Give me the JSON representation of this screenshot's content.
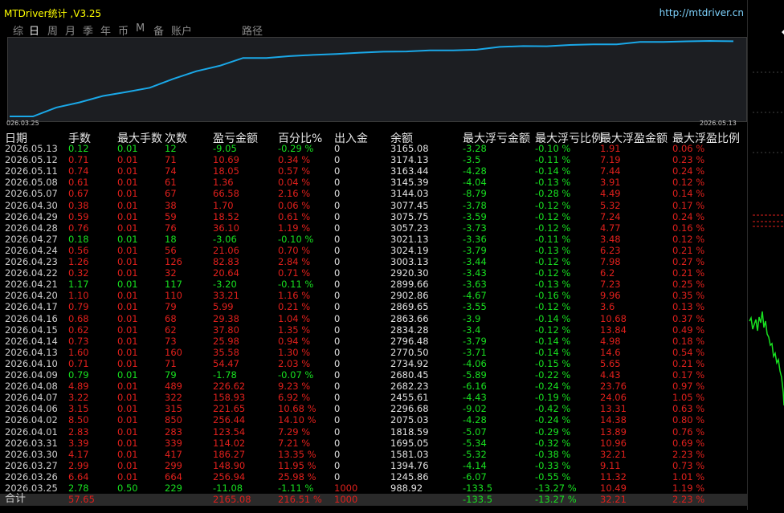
{
  "app": {
    "title": "MTDriver统计 ,V3.25",
    "url": "http://mtdriver.cn"
  },
  "tabs": [
    {
      "label": "综",
      "active": false
    },
    {
      "label": "日",
      "active": true
    },
    {
      "label": "周",
      "active": false
    },
    {
      "label": "月",
      "active": false
    },
    {
      "label": "季",
      "active": false
    },
    {
      "label": "年",
      "active": false
    },
    {
      "label": "币",
      "active": false
    },
    {
      "label": "M",
      "active": false
    },
    {
      "label": "备",
      "active": false
    },
    {
      "label": "账户",
      "active": false
    },
    {
      "label": "路径",
      "active": false
    }
  ],
  "chart_data": {
    "type": "line",
    "x_start": "026.03.25",
    "x_end": "2026.05.13",
    "series": [
      {
        "values": [
          988.92,
          988.92,
          1245.86,
          1394.76,
          1581.03,
          1695.05,
          1818.59,
          2075.03,
          2296.68,
          2455.61,
          2682.23,
          2680.45,
          2734.92,
          2770.5,
          2796.48,
          2834.28,
          2863.66,
          2869.65,
          2902.86,
          2899.66,
          2920.3,
          3003.13,
          3024.19,
          3021.13,
          3057.23,
          3075.75,
          3077.45,
          3144.03,
          3145.39,
          3163.44,
          3174.13,
          3165.08
        ]
      }
    ],
    "color": "#1aa8e8"
  },
  "table": {
    "headers": [
      "日期",
      "手数",
      "最大手数",
      "次数",
      "盈亏金额",
      "百分比%",
      "出入金",
      "余额",
      "最大浮亏金额",
      "最大浮亏比例",
      "最大浮盈金额",
      "最大浮盈比例"
    ],
    "rows": [
      [
        "2026.05.13",
        "0.12",
        "0.01",
        "12",
        "-9.05",
        "-0.29 %",
        "0",
        "3165.08",
        "-3.28",
        "-0.10 %",
        "1.91",
        "0.06 %"
      ],
      [
        "2026.05.12",
        "0.71",
        "0.01",
        "71",
        "10.69",
        "0.34 %",
        "0",
        "3174.13",
        "-3.5",
        "-0.11 %",
        "7.19",
        "0.23 %"
      ],
      [
        "2026.05.11",
        "0.74",
        "0.01",
        "74",
        "18.05",
        "0.57 %",
        "0",
        "3163.44",
        "-4.28",
        "-0.14 %",
        "7.44",
        "0.24 %"
      ],
      [
        "2026.05.08",
        "0.61",
        "0.01",
        "61",
        "1.36",
        "0.04 %",
        "0",
        "3145.39",
        "-4.04",
        "-0.13 %",
        "3.91",
        "0.12 %"
      ],
      [
        "2026.05.07",
        "0.67",
        "0.01",
        "67",
        "66.58",
        "2.16 %",
        "0",
        "3144.03",
        "-8.79",
        "-0.28 %",
        "4.49",
        "0.14 %"
      ],
      [
        "2026.04.30",
        "0.38",
        "0.01",
        "38",
        "1.70",
        "0.06 %",
        "0",
        "3077.45",
        "-3.78",
        "-0.12 %",
        "5.32",
        "0.17 %"
      ],
      [
        "2026.04.29",
        "0.59",
        "0.01",
        "59",
        "18.52",
        "0.61 %",
        "0",
        "3075.75",
        "-3.59",
        "-0.12 %",
        "7.24",
        "0.24 %"
      ],
      [
        "2026.04.28",
        "0.76",
        "0.01",
        "76",
        "36.10",
        "1.19 %",
        "0",
        "3057.23",
        "-3.73",
        "-0.12 %",
        "4.77",
        "0.16 %"
      ],
      [
        "2026.04.27",
        "0.18",
        "0.01",
        "18",
        "-3.06",
        "-0.10 %",
        "0",
        "3021.13",
        "-3.36",
        "-0.11 %",
        "3.48",
        "0.12 %"
      ],
      [
        "2026.04.24",
        "0.56",
        "0.01",
        "56",
        "21.06",
        "0.70 %",
        "0",
        "3024.19",
        "-3.79",
        "-0.13 %",
        "6.23",
        "0.21 %"
      ],
      [
        "2026.04.23",
        "1.26",
        "0.01",
        "126",
        "82.83",
        "2.84 %",
        "0",
        "3003.13",
        "-3.44",
        "-0.12 %",
        "7.98",
        "0.27 %"
      ],
      [
        "2026.04.22",
        "0.32",
        "0.01",
        "32",
        "20.64",
        "0.71 %",
        "0",
        "2920.30",
        "-3.43",
        "-0.12 %",
        "6.2",
        "0.21 %"
      ],
      [
        "2026.04.21",
        "1.17",
        "0.01",
        "117",
        "-3.20",
        "-0.11 %",
        "0",
        "2899.66",
        "-3.63",
        "-0.13 %",
        "7.23",
        "0.25 %"
      ],
      [
        "2026.04.20",
        "1.10",
        "0.01",
        "110",
        "33.21",
        "1.16 %",
        "0",
        "2902.86",
        "-4.67",
        "-0.16 %",
        "9.96",
        "0.35 %"
      ],
      [
        "2026.04.17",
        "0.79",
        "0.01",
        "79",
        "5.99",
        "0.21 %",
        "0",
        "2869.65",
        "-3.55",
        "-0.12 %",
        "3.6",
        "0.13 %"
      ],
      [
        "2026.04.16",
        "0.68",
        "0.01",
        "68",
        "29.38",
        "1.04 %",
        "0",
        "2863.66",
        "-3.9",
        "-0.14 %",
        "10.68",
        "0.37 %"
      ],
      [
        "2026.04.15",
        "0.62",
        "0.01",
        "62",
        "37.80",
        "1.35 %",
        "0",
        "2834.28",
        "-3.4",
        "-0.12 %",
        "13.84",
        "0.49 %"
      ],
      [
        "2026.04.14",
        "0.73",
        "0.01",
        "73",
        "25.98",
        "0.94 %",
        "0",
        "2796.48",
        "-3.79",
        "-0.14 %",
        "4.98",
        "0.18 %"
      ],
      [
        "2026.04.13",
        "1.60",
        "0.01",
        "160",
        "35.58",
        "1.30 %",
        "0",
        "2770.50",
        "-3.71",
        "-0.14 %",
        "14.6",
        "0.54 %"
      ],
      [
        "2026.04.10",
        "0.71",
        "0.01",
        "71",
        "54.47",
        "2.03 %",
        "0",
        "2734.92",
        "-4.06",
        "-0.15 %",
        "5.65",
        "0.21 %"
      ],
      [
        "2026.04.09",
        "0.79",
        "0.01",
        "79",
        "-1.78",
        "-0.07 %",
        "0",
        "2680.45",
        "-5.89",
        "-0.22 %",
        "4.43",
        "0.17 %"
      ],
      [
        "2026.04.08",
        "4.89",
        "0.01",
        "489",
        "226.62",
        "9.23 %",
        "0",
        "2682.23",
        "-6.16",
        "-0.24 %",
        "23.76",
        "0.97 %"
      ],
      [
        "2026.04.07",
        "3.22",
        "0.01",
        "322",
        "158.93",
        "6.92 %",
        "0",
        "2455.61",
        "-4.43",
        "-0.19 %",
        "24.06",
        "1.05 %"
      ],
      [
        "2026.04.06",
        "3.15",
        "0.01",
        "315",
        "221.65",
        "10.68 %",
        "0",
        "2296.68",
        "-9.02",
        "-0.42 %",
        "13.31",
        "0.63 %"
      ],
      [
        "2026.04.02",
        "8.50",
        "0.01",
        "850",
        "256.44",
        "14.10 %",
        "0",
        "2075.03",
        "-4.28",
        "-0.24 %",
        "14.38",
        "0.80 %"
      ],
      [
        "2026.04.01",
        "2.83",
        "0.01",
        "283",
        "123.54",
        "7.29 %",
        "0",
        "1818.59",
        "-5.07",
        "-0.29 %",
        "13.89",
        "0.76 %"
      ],
      [
        "2026.03.31",
        "3.39",
        "0.01",
        "339",
        "114.02",
        "7.21 %",
        "0",
        "1695.05",
        "-5.34",
        "-0.32 %",
        "10.96",
        "0.69 %"
      ],
      [
        "2026.03.30",
        "4.17",
        "0.01",
        "417",
        "186.27",
        "13.35 %",
        "0",
        "1581.03",
        "-5.32",
        "-0.38 %",
        "32.21",
        "2.23 %"
      ],
      [
        "2026.03.27",
        "2.99",
        "0.01",
        "299",
        "148.90",
        "11.95 %",
        "0",
        "1394.76",
        "-4.14",
        "-0.33 %",
        "9.11",
        "0.73 %"
      ],
      [
        "2026.03.26",
        "6.64",
        "0.01",
        "664",
        "256.94",
        "25.98 %",
        "0",
        "1245.86",
        "-6.07",
        "-0.55 %",
        "11.32",
        "1.01 %"
      ],
      [
        "2026.03.25",
        "2.78",
        "0.50",
        "229",
        "-11.08",
        "-1.11 %",
        "1000",
        "988.92",
        "-133.5",
        "-13.27 %",
        "10.49",
        "1.19 %"
      ]
    ],
    "summary": [
      "合计",
      "57.65",
      "",
      "",
      "2165.08",
      "216.51 %",
      "1000",
      "",
      "-133.5",
      "-13.27 %",
      "32.21",
      "2.23 %"
    ]
  },
  "colors": {
    "positive": "#e0201c",
    "negative": "#18e020",
    "line": "#1aa8e8",
    "title": "#ffff00"
  }
}
